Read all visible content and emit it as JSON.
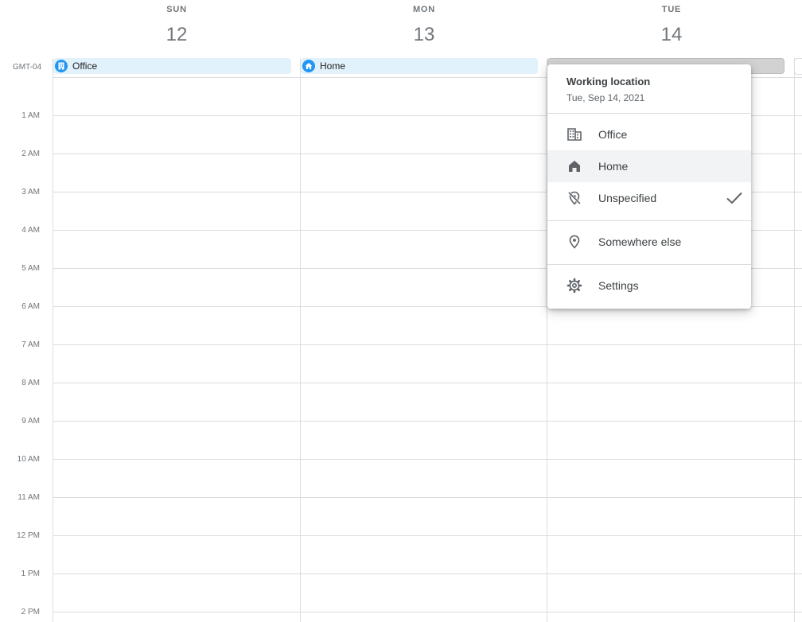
{
  "timezone": "GMT-04",
  "days": [
    {
      "name": "SUN",
      "date": "12"
    },
    {
      "name": "MON",
      "date": "13"
    },
    {
      "name": "TUE",
      "date": "14"
    }
  ],
  "allday": {
    "sun_chip": {
      "label": "Office",
      "icon": "building-icon"
    },
    "mon_chip": {
      "label": "Home",
      "icon": "home-icon"
    }
  },
  "hours": [
    "1 AM",
    "2 AM",
    "3 AM",
    "4 AM",
    "5 AM",
    "6 AM",
    "7 AM",
    "8 AM",
    "9 AM",
    "10 AM",
    "11 AM",
    "12 PM",
    "1 PM",
    "2 PM"
  ],
  "menu": {
    "title": "Working location",
    "subtitle": "Tue, Sep 14, 2021",
    "items": [
      {
        "label": "Office",
        "icon": "building-icon"
      },
      {
        "label": "Home",
        "icon": "home-icon",
        "highlighted": true
      },
      {
        "label": "Unspecified",
        "icon": "location-off-icon",
        "checked": true
      },
      {
        "label": "Somewhere else",
        "icon": "location-pin-icon"
      },
      {
        "label": "Settings",
        "icon": "gear-icon"
      }
    ]
  },
  "colors": {
    "chip_bg": "#e1f2fc",
    "chip_icon": "#2196f3",
    "grid_line": "#dadce0",
    "muted_text": "#70757a"
  }
}
